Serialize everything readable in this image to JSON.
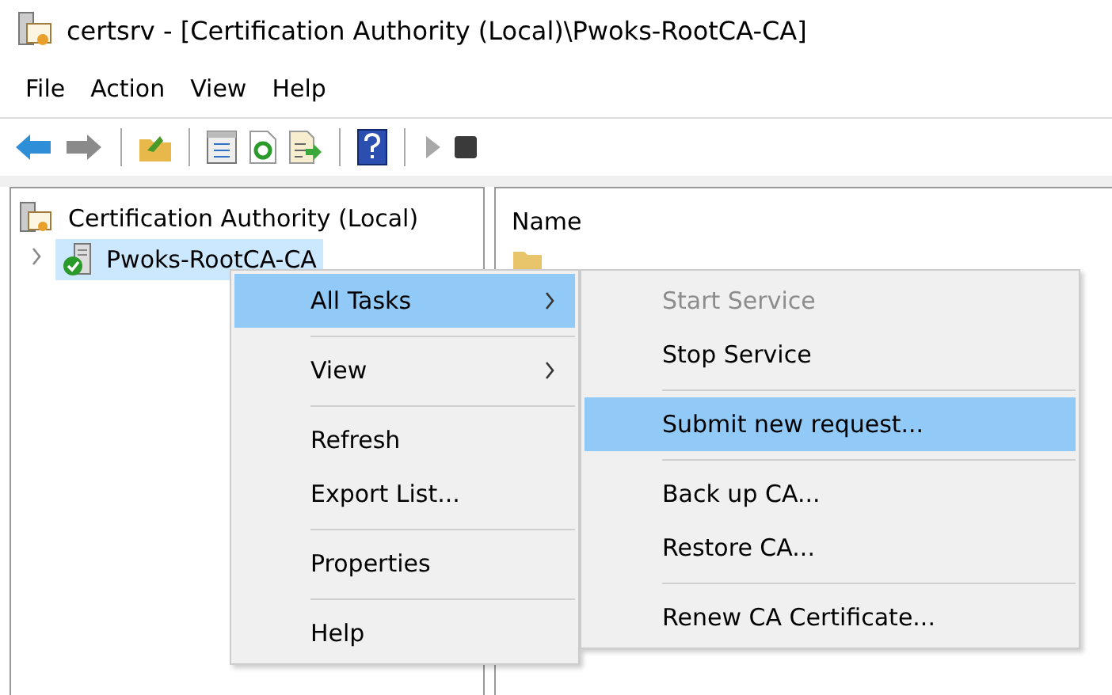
{
  "window": {
    "title": "certsrv - [Certification Authority (Local)\\Pwoks-RootCA-CA]"
  },
  "menu_bar": [
    {
      "label": "File"
    },
    {
      "label": "Action"
    },
    {
      "label": "View"
    },
    {
      "label": "Help"
    }
  ],
  "toolbar": [
    {
      "kind": "back",
      "disabled": false
    },
    {
      "kind": "forward",
      "disabled": true
    },
    {
      "kind": "separator"
    },
    {
      "kind": "up",
      "disabled": false
    },
    {
      "kind": "separator"
    },
    {
      "kind": "console",
      "disabled": false
    },
    {
      "kind": "refresh",
      "disabled": false
    },
    {
      "kind": "export",
      "disabled": false
    },
    {
      "kind": "separator"
    },
    {
      "kind": "help",
      "disabled": false
    },
    {
      "kind": "separator"
    },
    {
      "kind": "start",
      "disabled": true
    },
    {
      "kind": "stop",
      "disabled": false
    }
  ],
  "tree": [
    {
      "label": "Certification Authority (Local)",
      "selected": false,
      "children": [
        {
          "label": "Pwoks-RootCA-CA",
          "selected": true,
          "expanded": false
        }
      ]
    }
  ],
  "list_view": {
    "columns": [
      {
        "label": "Name"
      }
    ]
  },
  "context_menu": [
    {
      "kind": "item",
      "label": "All Tasks",
      "selected": true,
      "submenu": true
    },
    {
      "kind": "separator"
    },
    {
      "kind": "item",
      "label": "View",
      "selected": false,
      "submenu": true
    },
    {
      "kind": "separator"
    },
    {
      "kind": "item",
      "label": "Refresh",
      "selected": false,
      "submenu": false
    },
    {
      "kind": "item",
      "label": "Export List...",
      "selected": false,
      "submenu": false
    },
    {
      "kind": "separator"
    },
    {
      "kind": "item",
      "label": "Properties",
      "selected": false,
      "submenu": false
    },
    {
      "kind": "separator"
    },
    {
      "kind": "item",
      "label": "Help",
      "selected": false,
      "submenu": false
    }
  ],
  "submenu": [
    {
      "kind": "item",
      "label": "Start Service",
      "selected": false,
      "disabled": true
    },
    {
      "kind": "item",
      "label": "Stop Service",
      "selected": false,
      "disabled": false
    },
    {
      "kind": "separator"
    },
    {
      "kind": "item",
      "label": "Submit new request...",
      "selected": true,
      "disabled": false
    },
    {
      "kind": "separator"
    },
    {
      "kind": "item",
      "label": "Back up CA...",
      "selected": false,
      "disabled": false
    },
    {
      "kind": "item",
      "label": "Restore CA...",
      "selected": false,
      "disabled": false
    },
    {
      "kind": "separator"
    },
    {
      "kind": "item",
      "label": "Renew CA Certificate...",
      "selected": false,
      "disabled": false
    }
  ]
}
